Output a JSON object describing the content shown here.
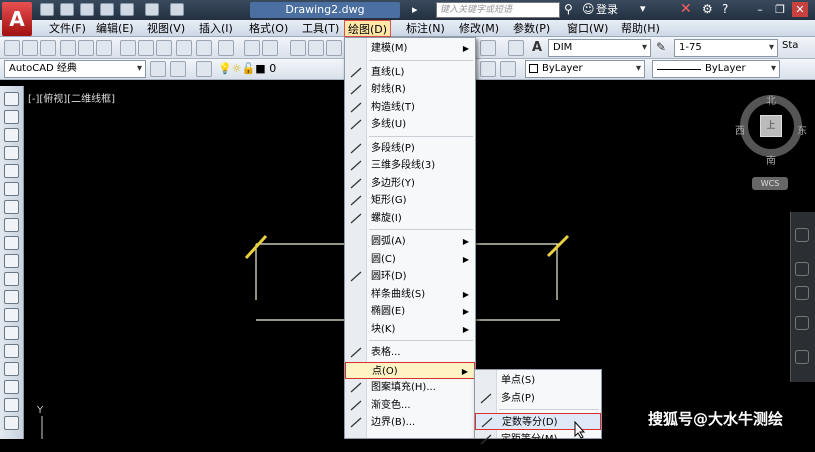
{
  "app": {
    "logo": "A",
    "document_title": "Drawing2.dwg",
    "search_placeholder": "键入关键字或短语",
    "login_label": "登录"
  },
  "menubar": [
    "文件(F)",
    "编辑(E)",
    "视图(V)",
    "插入(I)",
    "格式(O)",
    "工具(T)",
    "绘图(D)",
    "标注(N)",
    "修改(M)",
    "参数(P)",
    "窗口(W)",
    "帮助(H)"
  ],
  "toolbar": {
    "dimstyle": "DIM",
    "scale": "1-75",
    "truncated_label": "Sta",
    "workspace": "AutoCAD 经典",
    "layer_value": "0",
    "color": "ByLayer",
    "linetype": "ByLayer"
  },
  "viewport": {
    "label": "[-][俯视][二维线框]",
    "viewcube": {
      "north": "北",
      "south": "南",
      "east": "东",
      "west": "西",
      "face": "上"
    },
    "wcs": "WCS",
    "axis_y": "Y"
  },
  "draw_menu": [
    {
      "label": "建模(M)",
      "icon": "",
      "arrow": true
    },
    {
      "sep": true
    },
    {
      "label": "直线(L)",
      "icon": "line-icon"
    },
    {
      "label": "射线(R)",
      "icon": "ray-icon"
    },
    {
      "label": "构造线(T)",
      "icon": "xline-icon"
    },
    {
      "label": "多线(U)",
      "icon": "mline-icon"
    },
    {
      "sep": true
    },
    {
      "label": "多段线(P)",
      "icon": "pline-icon"
    },
    {
      "label": "三维多段线(3)",
      "icon": "3dpoly-icon"
    },
    {
      "label": "多边形(Y)",
      "icon": "polygon-icon"
    },
    {
      "label": "矩形(G)",
      "icon": "rectangle-icon"
    },
    {
      "label": "螺旋(I)",
      "icon": "helix-icon"
    },
    {
      "sep": true
    },
    {
      "label": "圆弧(A)",
      "icon": "",
      "arrow": true
    },
    {
      "label": "圆(C)",
      "icon": "",
      "arrow": true
    },
    {
      "label": "圆环(D)",
      "icon": "donut-icon"
    },
    {
      "label": "样条曲线(S)",
      "icon": "",
      "arrow": true
    },
    {
      "label": "椭圆(E)",
      "icon": "",
      "arrow": true
    },
    {
      "label": "块(K)",
      "icon": "",
      "arrow": true
    },
    {
      "sep": true
    },
    {
      "label": "表格...",
      "icon": "table-icon"
    },
    {
      "label": "点(O)",
      "icon": "",
      "arrow": true,
      "active": true
    },
    {
      "label": "图案填充(H)...",
      "icon": "hatch-icon"
    },
    {
      "label": "渐变色...",
      "icon": "gradient-icon"
    },
    {
      "label": "边界(B)...",
      "icon": "boundary-icon"
    }
  ],
  "point_submenu": [
    {
      "label": "单点(S)",
      "icon": ""
    },
    {
      "label": "多点(P)",
      "icon": "dot-icon"
    },
    {
      "sep": true
    },
    {
      "label": "定数等分(D)",
      "icon": "divide-icon",
      "highlight": true
    },
    {
      "label": "定距等分(M)",
      "icon": "measure-icon"
    }
  ],
  "watermark": "搜狐号@大水牛测绘",
  "colors": {
    "accent_red": "#d83030",
    "drawing_line": "#f0f0d0",
    "yellow_mark": "#e8d040"
  }
}
